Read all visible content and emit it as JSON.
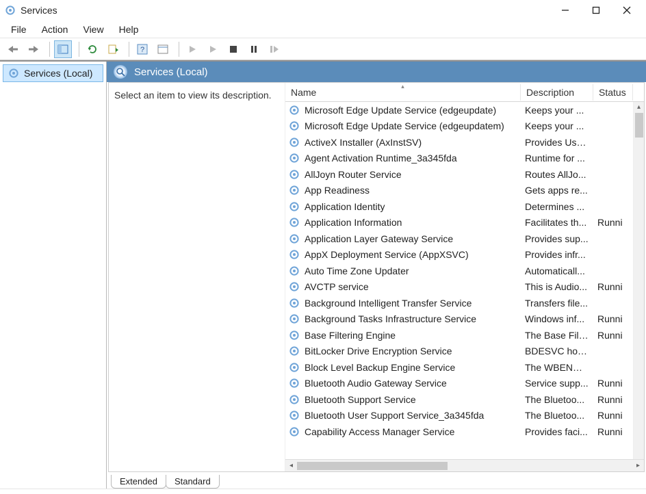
{
  "window": {
    "title": "Services"
  },
  "menu": {
    "file": "File",
    "action": "Action",
    "view": "View",
    "help": "Help"
  },
  "sidebar": {
    "root": "Services (Local)"
  },
  "panel": {
    "header": "Services (Local)",
    "hint": "Select an item to view its description."
  },
  "columns": {
    "name": "Name",
    "description": "Description",
    "status": "Status"
  },
  "tabs": {
    "extended": "Extended",
    "standard": "Standard"
  },
  "services": [
    {
      "name": "Microsoft Edge Update Service (edgeupdate)",
      "desc": "Keeps your ...",
      "status": ""
    },
    {
      "name": "Microsoft Edge Update Service (edgeupdatem)",
      "desc": "Keeps your ...",
      "status": ""
    },
    {
      "name": "ActiveX Installer (AxInstSV)",
      "desc": "Provides Use...",
      "status": ""
    },
    {
      "name": "Agent Activation Runtime_3a345fda",
      "desc": "Runtime for ...",
      "status": ""
    },
    {
      "name": "AllJoyn Router Service",
      "desc": "Routes AllJo...",
      "status": ""
    },
    {
      "name": "App Readiness",
      "desc": "Gets apps re...",
      "status": ""
    },
    {
      "name": "Application Identity",
      "desc": "Determines ...",
      "status": ""
    },
    {
      "name": "Application Information",
      "desc": "Facilitates th...",
      "status": "Runni"
    },
    {
      "name": "Application Layer Gateway Service",
      "desc": "Provides sup...",
      "status": ""
    },
    {
      "name": "AppX Deployment Service (AppXSVC)",
      "desc": "Provides infr...",
      "status": ""
    },
    {
      "name": "Auto Time Zone Updater",
      "desc": "Automaticall...",
      "status": ""
    },
    {
      "name": "AVCTP service",
      "desc": "This is Audio...",
      "status": "Runni"
    },
    {
      "name": "Background Intelligent Transfer Service",
      "desc": "Transfers file...",
      "status": ""
    },
    {
      "name": "Background Tasks Infrastructure Service",
      "desc": "Windows inf...",
      "status": "Runni"
    },
    {
      "name": "Base Filtering Engine",
      "desc": "The Base Filt...",
      "status": "Runni"
    },
    {
      "name": "BitLocker Drive Encryption Service",
      "desc": "BDESVC hos...",
      "status": ""
    },
    {
      "name": "Block Level Backup Engine Service",
      "desc": "The WBENGI...",
      "status": ""
    },
    {
      "name": "Bluetooth Audio Gateway Service",
      "desc": "Service supp...",
      "status": "Runni"
    },
    {
      "name": "Bluetooth Support Service",
      "desc": "The Bluetoo...",
      "status": "Runni"
    },
    {
      "name": "Bluetooth User Support Service_3a345fda",
      "desc": "The Bluetoo...",
      "status": "Runni"
    },
    {
      "name": "Capability Access Manager Service",
      "desc": "Provides faci...",
      "status": "Runni"
    }
  ]
}
